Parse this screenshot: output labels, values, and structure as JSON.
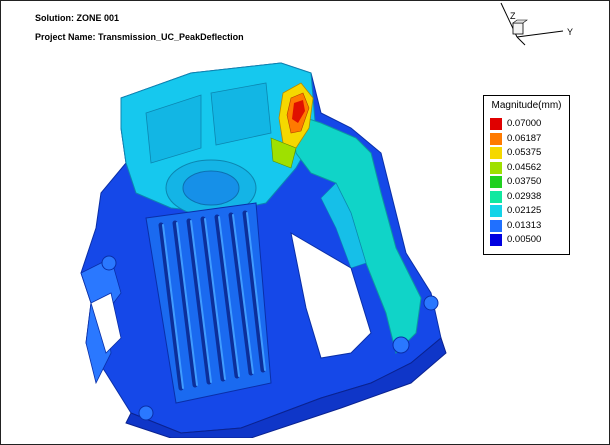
{
  "header": {
    "solution": "Solution: ZONE 001",
    "project": "Project Name: Transmission_UC_PeakDeflection"
  },
  "triad": {
    "z_label": "Z",
    "y_label": "Y"
  },
  "legend": {
    "title": "Magnitude(mm)",
    "entries": [
      {
        "value": "0.07000",
        "color": "#e00000"
      },
      {
        "value": "0.06187",
        "color": "#ff7a00"
      },
      {
        "value": "0.05375",
        "color": "#f5d800"
      },
      {
        "value": "0.04562",
        "color": "#9fe000"
      },
      {
        "value": "0.03750",
        "color": "#20d020"
      },
      {
        "value": "0.02938",
        "color": "#10e8a0"
      },
      {
        "value": "0.02125",
        "color": "#14d4e8"
      },
      {
        "value": "0.01313",
        "color": "#2070ff"
      },
      {
        "value": "0.00500",
        "color": "#0000e0"
      }
    ]
  },
  "colors": {
    "background": "#ffffff",
    "model_dark_blue": "#1548e8",
    "model_mid_blue": "#2a78ff",
    "model_cyan": "#16c8ee",
    "model_teal": "#10d8b8",
    "peak_red": "#e01000"
  }
}
